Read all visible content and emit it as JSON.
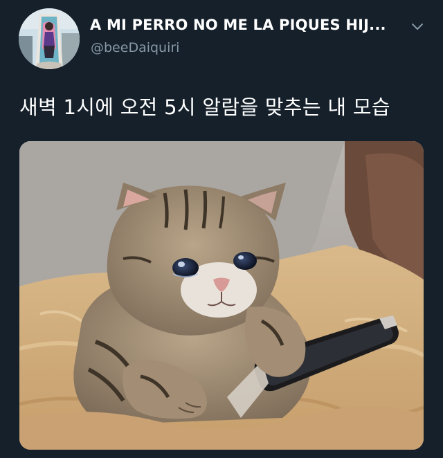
{
  "tweet": {
    "display_name": "A MI PERRO NO ME LA PIQUES HIJ...",
    "handle": "@beeDaiquiri",
    "text": "새벽 1시에 오전 5시 알람을 맞추는 내 모습"
  },
  "icons": {
    "more": "chevron-down-icon"
  },
  "colors": {
    "background": "#15202b",
    "secondary_text": "#8899a6",
    "primary_text": "#ffffff"
  }
}
